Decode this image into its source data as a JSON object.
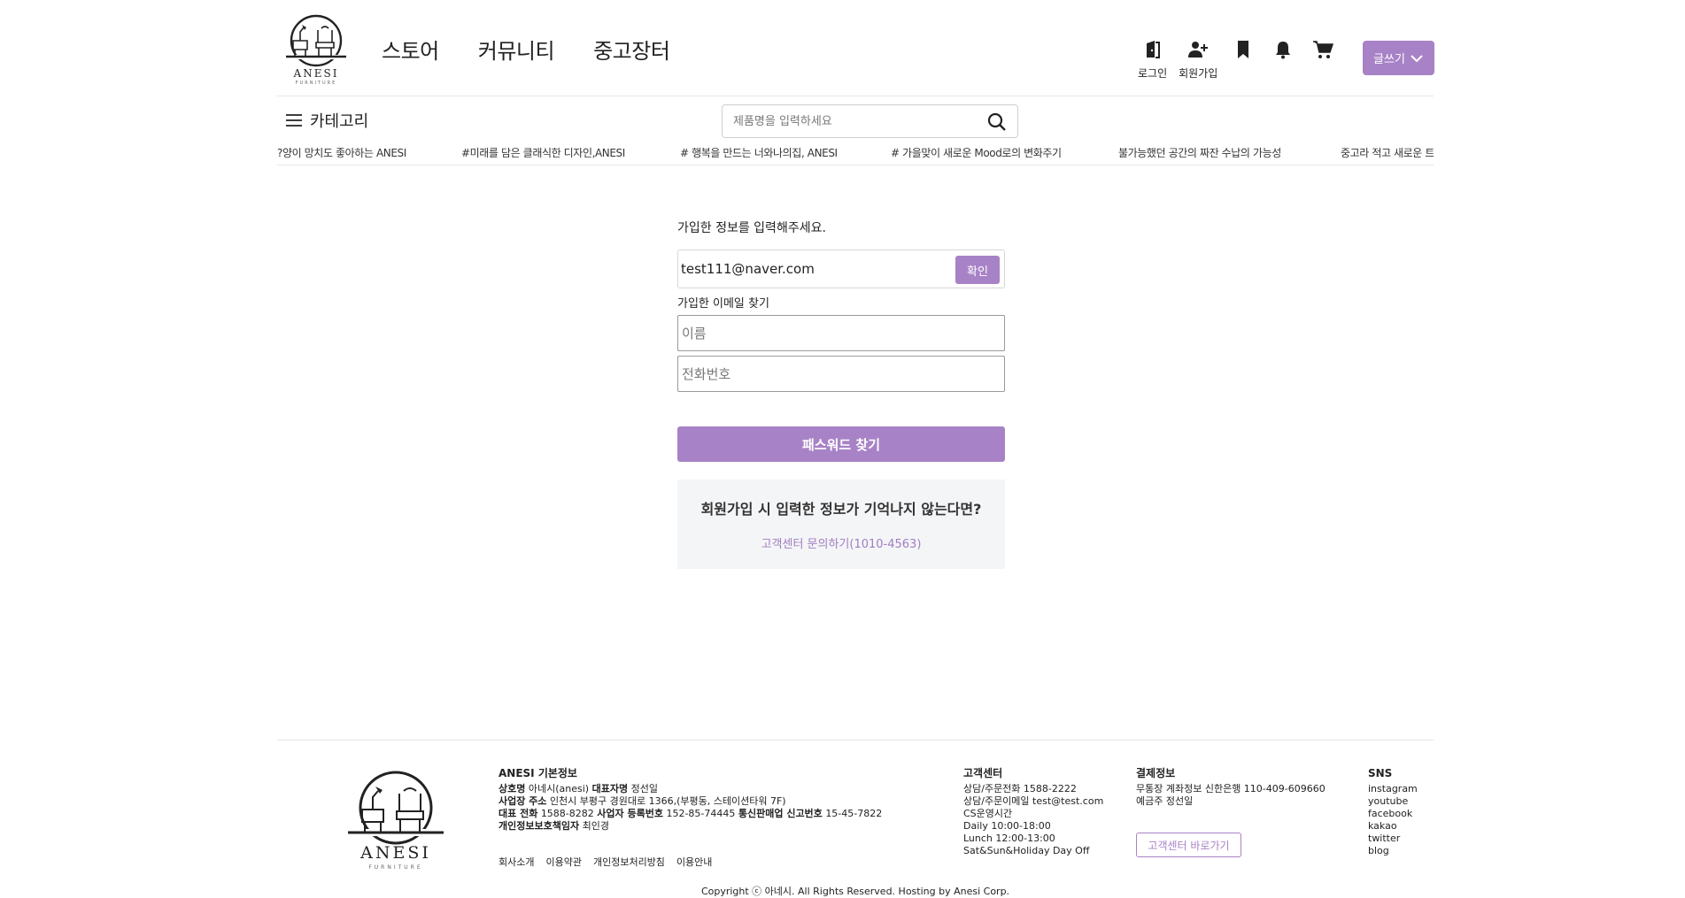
{
  "header": {
    "brand": "ANESI",
    "brand_sub": "FURNITURE",
    "nav": [
      "스토어",
      "커뮤니티",
      "중고장터"
    ],
    "login_label": "로그인",
    "signup_label": "회원가입",
    "write_label": "글쓰기"
  },
  "subheader": {
    "category_label": "카테고리",
    "search_placeholder": "제품명을 입력하세요",
    "ticker": [
      "?양이 망치도 좋아하는 ANESI",
      "#미래를 담은 클래식한 디자인,ANESI",
      "# 행복을 만드는 너와나의집, ANESI",
      "# 가을맞이 새로운 Mood로의 변화주기",
      "불가능했던 공간의 짜잔 수납의 가능성",
      "중고라 적고 새로운 트"
    ]
  },
  "form": {
    "guide": "가입한 정보를 입력해주세요.",
    "email_value": "test111@naver.com",
    "confirm_label": "확인",
    "find_email_title": "가입한 이메일 찾기",
    "name_placeholder": "이름",
    "phone_placeholder": "전화번호",
    "submit_label": "패스워드 찾기",
    "help_question": "회원가입 시 입력한 정보가 기억나지 않는다면?",
    "help_link": "고객센터 문의하기(1010-4563)"
  },
  "footer": {
    "basic_title": "ANESI 기본정보",
    "company_key": "상호명",
    "company_val": "아네시(anesi)",
    "ceo_key": "대표자명",
    "ceo_val": "정선일",
    "addr_key": "사업장 주소",
    "addr_val": "인천시 부평구 경원대로 1366,(부평동, 스테이션타워 7F)",
    "tel_key": "대표 전화",
    "tel_val": "1588-8282",
    "biz_key": "사업자 등록번호",
    "biz_val": "152-85-74445",
    "mail_key": "통신판매업 신고번호",
    "mail_val": "15-45-7822",
    "privacy_key": "개인정보보호책임자",
    "privacy_val": "최인경",
    "links": [
      "회사소개",
      "이용약관",
      "개인정보처리방침",
      "이용안내"
    ],
    "cs_title": "고객센터",
    "cs_lines": [
      "상담/주문전화 1588-2222",
      "상담/주문이메일 test@test.com",
      "CS운영시간",
      "Daily 10:00-18:00",
      "Lunch 12:00-13:00",
      "Sat&Sun&Holiday Day Off"
    ],
    "pay_title": "결제정보",
    "pay_lines": [
      "무통장 계좌정보 신한은행 110-409-609660",
      "예금주 정선일"
    ],
    "cs_button": "고객센터 바로가기",
    "sns_title": "SNS",
    "sns": [
      "instagram",
      "youtube",
      "facebook",
      "kakao",
      "twitter",
      "blog"
    ],
    "copyright": "Copyright ⓒ 아네시. All Rights Reserved. Hosting by Anesi Corp."
  },
  "colors": {
    "accent": "#a882c6",
    "help_bg": "#f4f5f7",
    "help_link": "#a07ec0"
  },
  "icons": [
    "door-login-icon",
    "user-plus-icon",
    "bookmark-icon",
    "bell-icon",
    "cart-icon",
    "chevron-down-icon",
    "hamburger-icon",
    "search-icon",
    "anesi-logo-icon"
  ]
}
